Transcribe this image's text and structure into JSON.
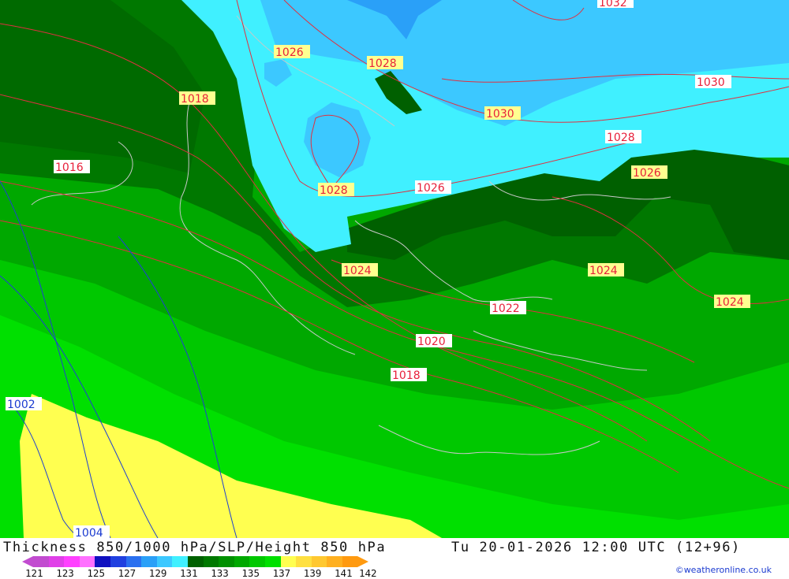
{
  "map": {
    "pressure_labels": [
      {
        "text": "1032",
        "kind": "red"
      },
      {
        "text": "1026",
        "kind": "red"
      },
      {
        "text": "1028",
        "kind": "red"
      },
      {
        "text": "1018",
        "kind": "red"
      },
      {
        "text": "1030",
        "kind": "red"
      },
      {
        "text": "1030",
        "kind": "red"
      },
      {
        "text": "1028",
        "kind": "red"
      },
      {
        "text": "1016",
        "kind": "red"
      },
      {
        "text": "1026",
        "kind": "red"
      },
      {
        "text": "1028",
        "kind": "red"
      },
      {
        "text": "1026",
        "kind": "red"
      },
      {
        "text": "1024",
        "kind": "red"
      },
      {
        "text": "1024",
        "kind": "red"
      },
      {
        "text": "1024",
        "kind": "red"
      },
      {
        "text": "1022",
        "kind": "red"
      },
      {
        "text": "1020",
        "kind": "red"
      },
      {
        "text": "1018",
        "kind": "red"
      },
      {
        "text": "1002",
        "kind": "blue"
      },
      {
        "text": "1004",
        "kind": "blue"
      }
    ]
  },
  "footer": {
    "title": "Thickness 850/1000 hPa/SLP/Height 850 hPa",
    "datetime": "Tu 20-01-2026 12:00 UTC (12+96)",
    "credit": "©weatheronline.co.uk"
  },
  "legend": {
    "colors": [
      "#c24cd0",
      "#e040e8",
      "#ff40ff",
      "#ff70ff",
      "#1010c0",
      "#2040e0",
      "#2a70f0",
      "#2aa0f8",
      "#3cc8ff",
      "#40f0ff",
      "#006000",
      "#007800",
      "#009000",
      "#00a800",
      "#00c800",
      "#00e000",
      "#ffff50",
      "#ffe040",
      "#ffc830",
      "#ffb020",
      "#ff9a10"
    ],
    "ticks": [
      "121",
      "123",
      "125",
      "127",
      "129",
      "131",
      "133",
      "135",
      "137",
      "139",
      "141",
      "142"
    ]
  }
}
